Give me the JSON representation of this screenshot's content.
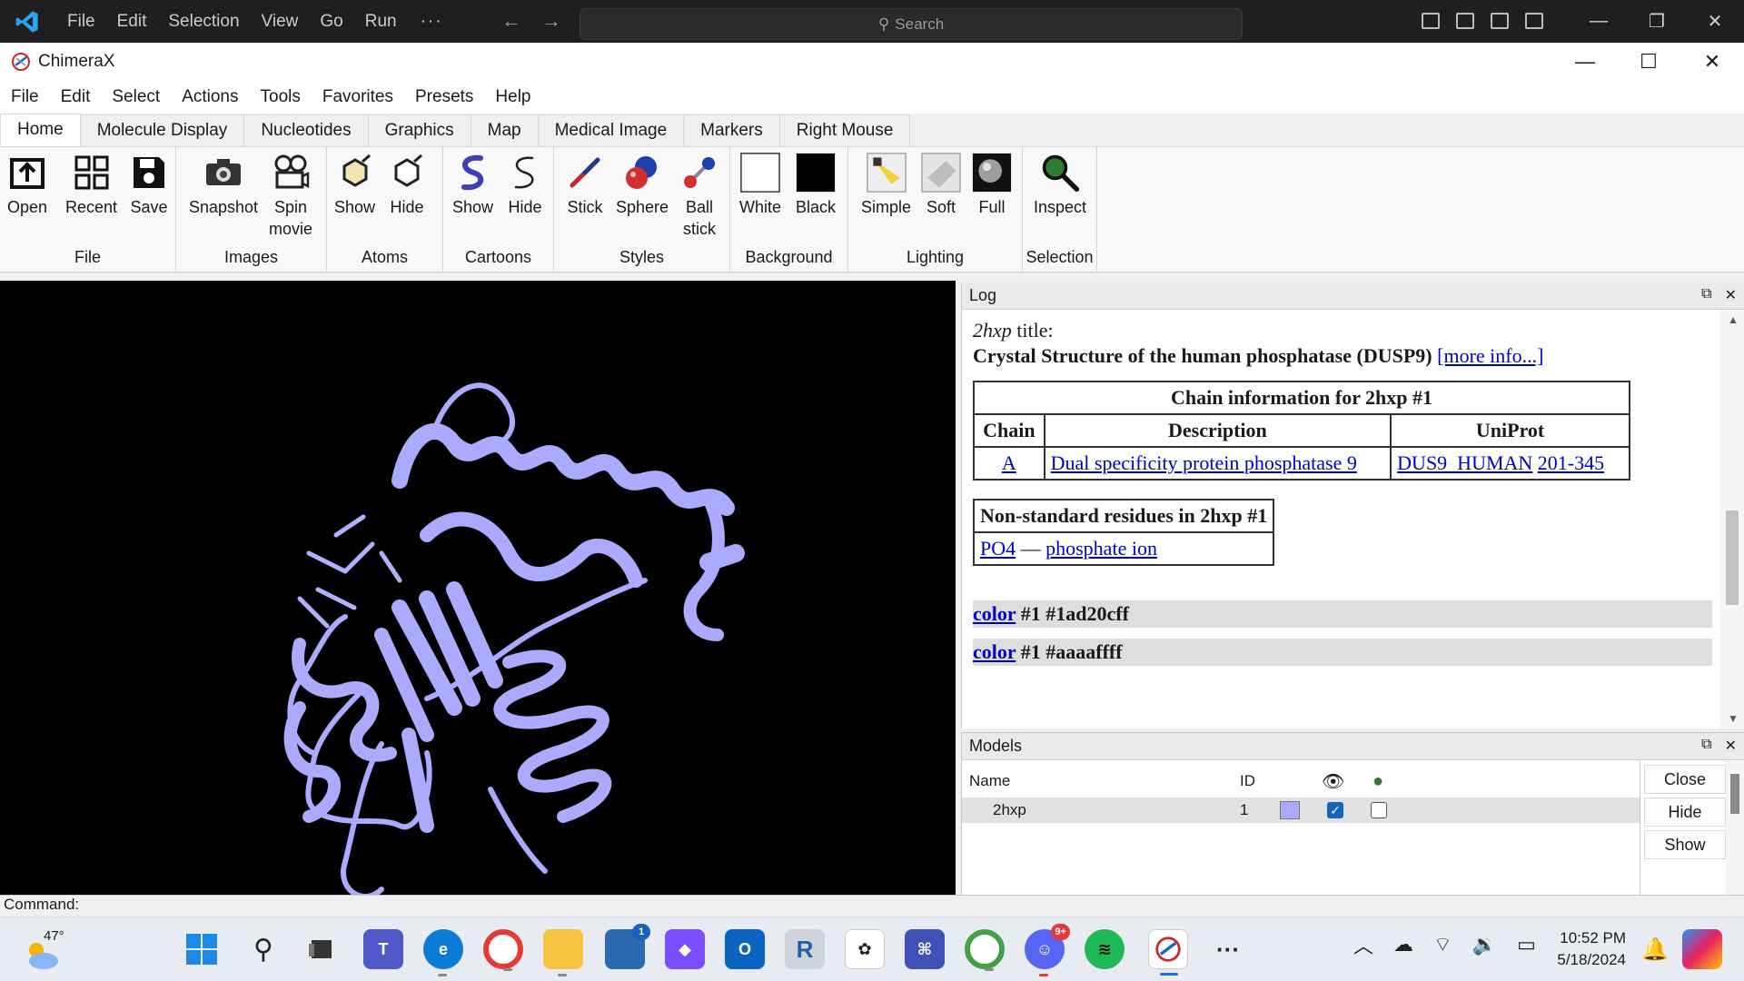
{
  "vscode": {
    "menu": [
      "File",
      "Edit",
      "Selection",
      "View",
      "Go",
      "Run"
    ],
    "more": "···",
    "search_placeholder": "Search"
  },
  "window": {
    "title": "ChimeraX"
  },
  "menubar": [
    "File",
    "Edit",
    "Select",
    "Actions",
    "Tools",
    "Favorites",
    "Presets",
    "Help"
  ],
  "tabs": [
    "Home",
    "Molecule Display",
    "Nucleotides",
    "Graphics",
    "Map",
    "Medical Image",
    "Markers",
    "Right Mouse"
  ],
  "ribbon": {
    "groups": {
      "file": "File",
      "images": "Images",
      "atoms": "Atoms",
      "cartoons": "Cartoons",
      "styles": "Styles",
      "background": "Background",
      "lighting": "Lighting",
      "selection": "Selection"
    },
    "buttons": {
      "open": "Open",
      "recent": "Recent",
      "save": "Save",
      "snapshot": "Snapshot",
      "spin_movie": "Spin movie",
      "atoms_show": "Show",
      "atoms_hide": "Hide",
      "cartoons_show": "Show",
      "cartoons_hide": "Hide",
      "stick": "Stick",
      "sphere": "Sphere",
      "ball_stick": "Ball stick",
      "white": "White",
      "black": "Black",
      "simple": "Simple",
      "soft": "Soft",
      "full": "Full",
      "inspect": "Inspect"
    }
  },
  "log": {
    "panel_title": "Log",
    "model_id": "2hxp",
    "title_label": "title:",
    "description": "Crystal Structure of the human phosphatase (DUSP9)",
    "more_info": "[more info...]",
    "chain_table": {
      "caption": "Chain information for 2hxp #1",
      "headers": [
        "Chain",
        "Description",
        "UniProt"
      ],
      "rows": [
        {
          "chain": "A",
          "description": "Dual specificity protein phosphatase 9",
          "uniprot_id": "DUS9_HUMAN",
          "uniprot_range": "201-345"
        }
      ]
    },
    "nonstd_table": {
      "caption": "Non-standard residues in 2hxp #1",
      "code": "PO4",
      "dash": "—",
      "name": "phosphate ion"
    },
    "commands": [
      {
        "cmd": "color",
        "args": "#1 #1ad20cff"
      },
      {
        "cmd": "color",
        "args": "#1 #aaaaffff"
      }
    ]
  },
  "models": {
    "panel_title": "Models",
    "headers": {
      "name": "Name",
      "id": "ID"
    },
    "rows": [
      {
        "name": "2hxp",
        "id": "1",
        "color": "#aaaaff",
        "shown": true,
        "selected": false
      }
    ],
    "buttons": {
      "close": "Close",
      "hide": "Hide",
      "show": "Show"
    }
  },
  "command_line": {
    "label": "Command:"
  },
  "taskbar": {
    "weather_temp": "47°",
    "outlook_badge": "1",
    "discord_badge": "9+",
    "time": "10:52 PM",
    "date": "5/18/2024"
  },
  "colors": {
    "protein": "#aaaaff",
    "viewer_bg": "#000000",
    "link": "#0000cc",
    "vscode_bar": "#1f1f1f"
  }
}
